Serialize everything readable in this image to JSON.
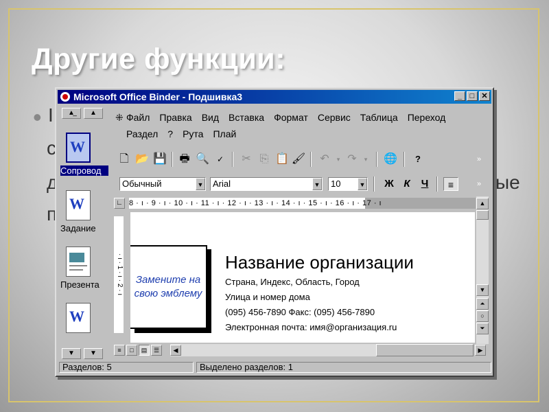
{
  "slide": {
    "title": "Другие функции:",
    "fragments": [
      "I",
      "с",
      "д",
      "п",
      "ые"
    ]
  },
  "window": {
    "title": "Microsoft Office Binder - Подшивка3",
    "buttons": [
      "_",
      "□",
      "✕"
    ]
  },
  "menu": {
    "row1": [
      "Файл",
      "Правка",
      "Вид",
      "Вставка",
      "Формат",
      "Сервис",
      "Таблица",
      "Переход"
    ],
    "row2": [
      "Раздел",
      "?",
      "Рута",
      "Плай"
    ]
  },
  "sections": [
    {
      "label": "Сопровод",
      "icon": "word-doc-icon",
      "glyph": "W",
      "selected": true
    },
    {
      "label": "Задание",
      "icon": "word-doc-icon",
      "glyph": "W",
      "selected": false
    },
    {
      "label": "Презента",
      "icon": "presentation-icon",
      "glyph": "",
      "selected": false
    },
    {
      "label": "",
      "icon": "word-doc-icon",
      "glyph": "W",
      "selected": false
    }
  ],
  "formatting": {
    "style": "Обычный",
    "font": "Arial",
    "size": "10",
    "bold": "Ж",
    "italic": "К",
    "underline": "Ч"
  },
  "ruler": {
    "ticks": "8 · ı · 9 · ı · 10 · ı · 11 · ı · 12 · ı · 13 · ı · 14 · ı · 15 · ı · 16 · ı · 17 · ı",
    "vertical": "· ı · 1 · ı · 2 · ı"
  },
  "document": {
    "emblem": "Замените на свою эмблему",
    "org_name": "Название организации",
    "lines": [
      "Страна, Индекс, Область, Город",
      "Улица и номер дома",
      "(095) 456-7890 Факс: (095) 456-7890",
      "Электронная почта: имя@организация.ru"
    ]
  },
  "status": {
    "sections": "Разделов: 5",
    "selected": "Выделено разделов: 1"
  }
}
